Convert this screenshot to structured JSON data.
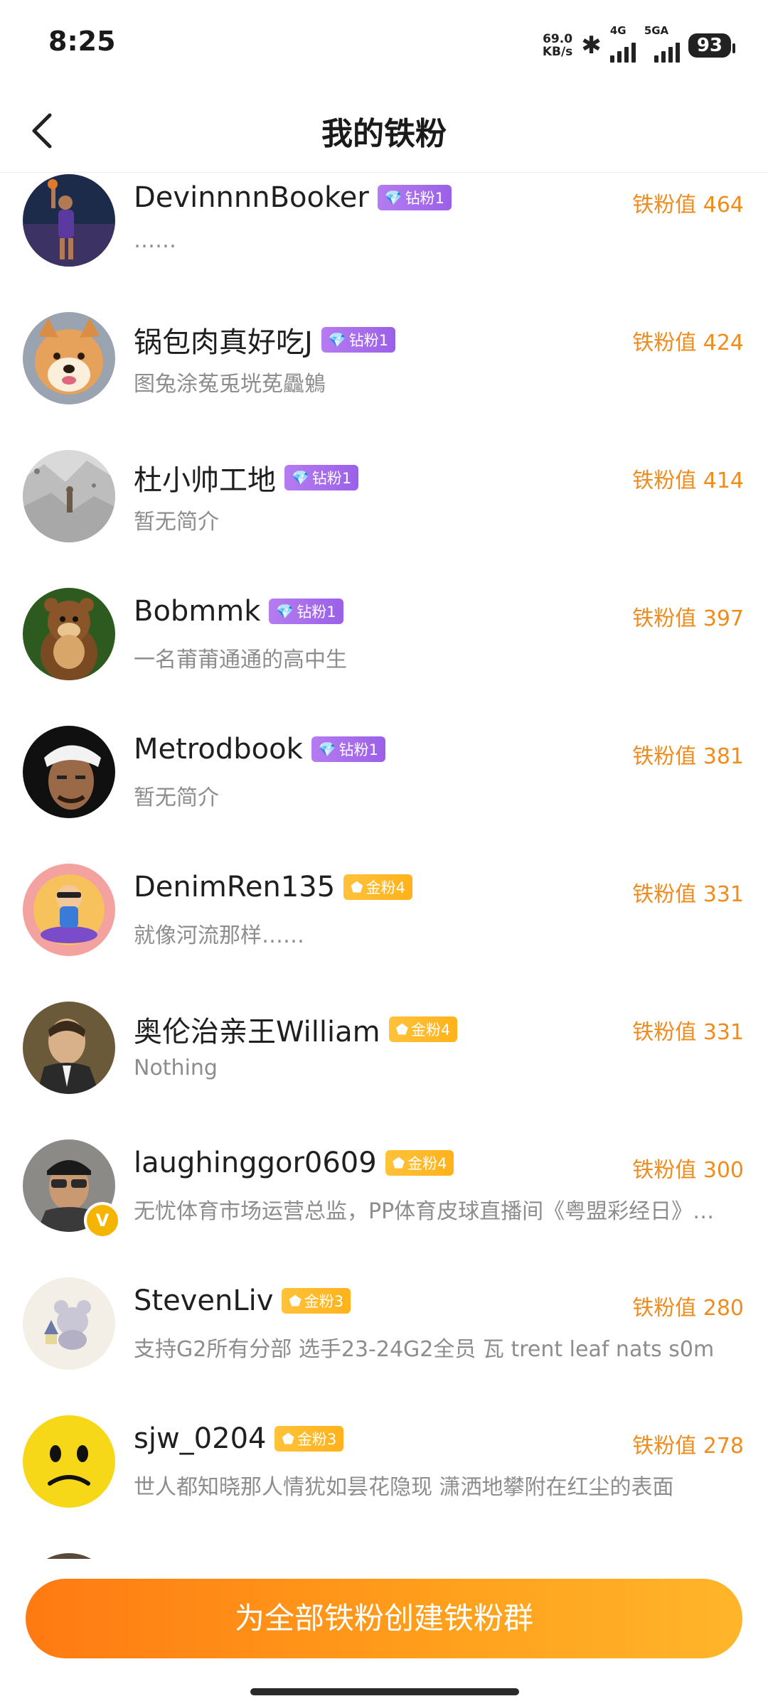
{
  "status_bar": {
    "time": "8:25",
    "net_speed_value": "69.0",
    "net_speed_unit": "KB/s",
    "signal_1_label": "4G",
    "signal_2_label": "5GA",
    "battery": "93"
  },
  "header": {
    "title": "我的铁粉",
    "back_icon": "chevron-left-icon"
  },
  "fans": [
    {
      "name": "DevinnnnBooker",
      "badge": "钻粉1",
      "badge_type": "diamond",
      "bio": "……",
      "score": "铁粉值 464"
    },
    {
      "name": "锅包肉真好吃J",
      "badge": "钻粉1",
      "badge_type": "diamond",
      "bio": "图兔涂菟兎垙莬飍鵵",
      "score": "铁粉值 424"
    },
    {
      "name": "杜小帅工地",
      "badge": "钻粉1",
      "badge_type": "diamond",
      "bio": "暂无简介",
      "score": "铁粉值 414"
    },
    {
      "name": "Bobmmk",
      "badge": "钻粉1",
      "badge_type": "diamond",
      "bio": "一名莆莆通通的高中生",
      "score": "铁粉值 397"
    },
    {
      "name": "Metrodbook",
      "badge": "钻粉1",
      "badge_type": "diamond",
      "bio": "暂无简介",
      "score": "铁粉值 381"
    },
    {
      "name": "DenimRen135",
      "badge": "金粉4",
      "badge_type": "gold",
      "bio": "就像河流那样……",
      "score": "铁粉值 331"
    },
    {
      "name": "奥伦治亲王William",
      "badge": "金粉4",
      "badge_type": "gold",
      "bio": "Nothing",
      "score": "铁粉值 331"
    },
    {
      "name": "laughinggor0609",
      "badge": "金粉4",
      "badge_type": "gold",
      "bio": "无忧体育市场运营总监，PP体育皮球直播间《粤盟彩经日》…",
      "score": "铁粉值 300",
      "verified": "V"
    },
    {
      "name": "StevenLiv",
      "badge": "金粉3",
      "badge_type": "gold",
      "bio": "支持G2所有分部 选手23-24G2全员 瓦 trent leaf nats s0m",
      "score": "铁粉值 280"
    },
    {
      "name": "sjw_0204",
      "badge": "金粉3",
      "badge_type": "gold",
      "bio": "世人都知晓那人情犹如昙花隐现 潇洒地攀附在红尘的表面",
      "score": "铁粉值 278"
    }
  ],
  "bottom_button": {
    "label": "为全部铁粉创建铁粉群"
  },
  "colors": {
    "accent_orange": "#f08c1d",
    "diamond_badge": "#a46cec",
    "gold_badge": "#ffb726",
    "button_gradient_start": "#ff7a12",
    "button_gradient_end": "#ffb52a"
  }
}
